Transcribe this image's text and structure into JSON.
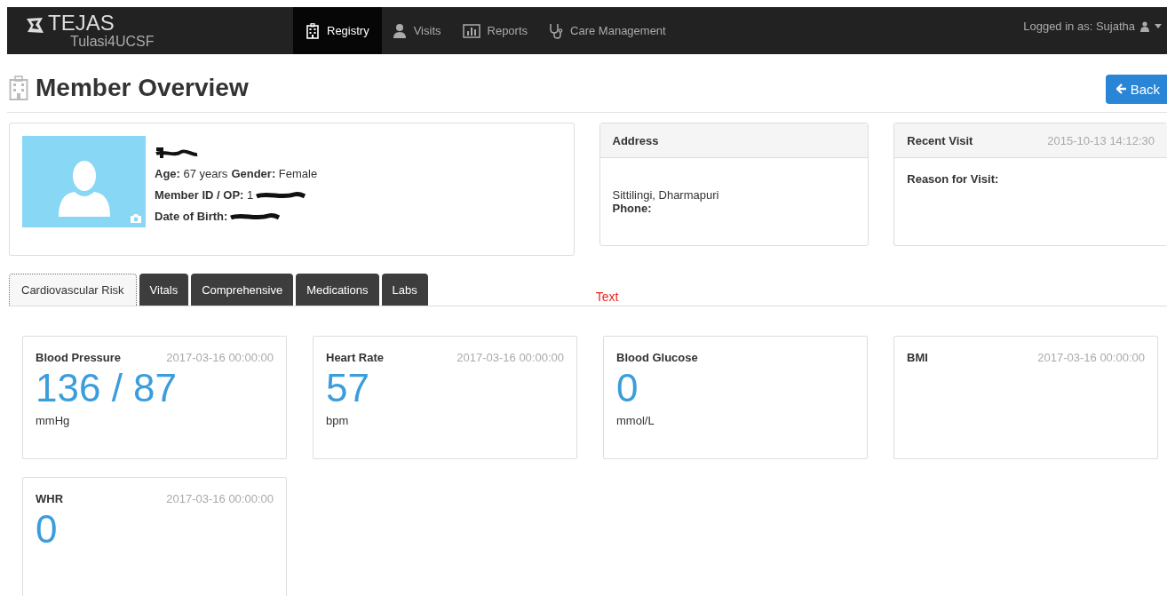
{
  "navbar": {
    "brand": "TEJAS",
    "subtitle": "Tulasi4UCSF",
    "items": [
      {
        "label": "Registry",
        "selected": true
      },
      {
        "label": "Visits",
        "selected": false
      },
      {
        "label": "Reports",
        "selected": false
      },
      {
        "label": "Care Management",
        "selected": false
      }
    ],
    "user": "Logged in as: Sujatha"
  },
  "page": {
    "title": "Member Overview",
    "back_button": "Back"
  },
  "member": {
    "name_redacted": true,
    "fields": [
      {
        "label": "Age:",
        "value": "67 years",
        "label2": "Gender:",
        "value2": "Female"
      },
      {
        "label": "Member ID / OP:",
        "value": "1",
        "redacted": true
      },
      {
        "label": "Date of Birth:",
        "redacted": true
      }
    ]
  },
  "address": {
    "heading": "Address",
    "line": "Sittilingi, Dharmapuri",
    "phone_label": "Phone:"
  },
  "recent_visit": {
    "heading": "Recent Visit",
    "time": "2015-10-13 14:12:30",
    "reason_label": "Reason for Visit:"
  },
  "tabs": [
    {
      "label": "Cardiovascular Risk",
      "selected": true
    },
    {
      "label": "Vitals",
      "selected": false
    },
    {
      "label": "Comprehensive",
      "selected": false
    },
    {
      "label": "Medications",
      "selected": false
    },
    {
      "label": "Labs",
      "selected": false
    }
  ],
  "tab_note": "Text",
  "metrics": [
    {
      "title": "Blood Pressure",
      "time": "2017-03-16 00:00:00",
      "value": "136 / 87",
      "unit": "mmHg"
    },
    {
      "title": "Heart Rate",
      "time": "2017-03-16 00:00:00",
      "value": "57",
      "unit": "bpm"
    },
    {
      "title": "Blood Glucose",
      "value": "0",
      "unit": "mmol/L"
    },
    {
      "title": "BMI",
      "time": "2017-03-16 00:00:00"
    },
    {
      "title": "WHR",
      "time": "2017-03-16 00:00:00",
      "value": "0"
    }
  ]
}
